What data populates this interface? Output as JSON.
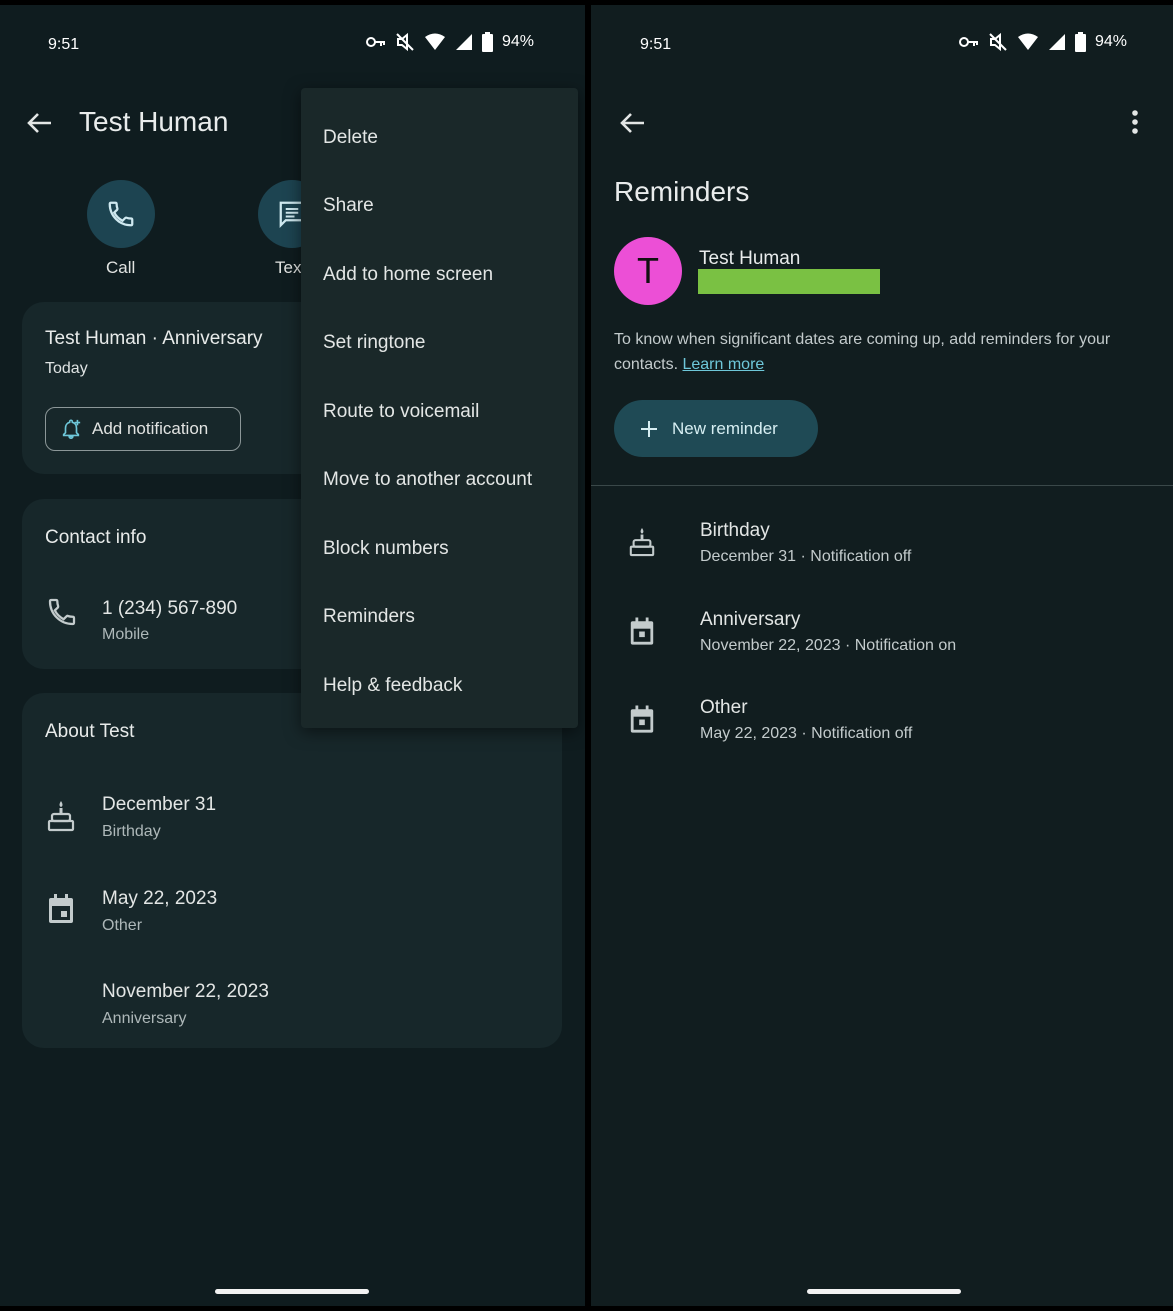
{
  "left": {
    "status": {
      "time": "9:51",
      "battery": "94%"
    },
    "title": "Test Human",
    "actions": [
      {
        "label": "Call"
      },
      {
        "label": "Tex"
      }
    ],
    "event_card": {
      "title": "Test Human · Anniversary",
      "subtitle": "Today",
      "button": "Add notification"
    },
    "contact_card": {
      "title": "Contact info",
      "phone": "1 (234) 567-890",
      "phone_type": "Mobile"
    },
    "about_card": {
      "title": "About Test",
      "rows": [
        {
          "date": "December 31",
          "type": "Birthday"
        },
        {
          "date": "May 22, 2023",
          "type": "Other"
        },
        {
          "date": "November 22, 2023",
          "type": "Anniversary"
        }
      ]
    },
    "menu": [
      "Delete",
      "Share",
      "Add to home screen",
      "Set ringtone",
      "Route to voicemail",
      "Move to another account",
      "Block numbers",
      "Reminders",
      "Help & feedback"
    ]
  },
  "right": {
    "status": {
      "time": "9:51",
      "battery": "94%"
    },
    "title": "Reminders",
    "contact": {
      "initial": "T",
      "name": "Test Human"
    },
    "info": "To know when significant dates are coming up, add reminders for your contacts.",
    "learn_more": "Learn more",
    "new_reminder": "New reminder",
    "reminders": [
      {
        "title": "Birthday",
        "sub": "December 31 · Notification off"
      },
      {
        "title": "Anniversary",
        "sub": "November 22, 2023 · Notification on"
      },
      {
        "title": "Other",
        "sub": "May 22, 2023 · Notification off"
      }
    ]
  },
  "colors": {
    "accent": "#6ec7d9",
    "avatar": "#ec4fd6",
    "redaction": "#7ac143",
    "button": "#1f4a55"
  }
}
